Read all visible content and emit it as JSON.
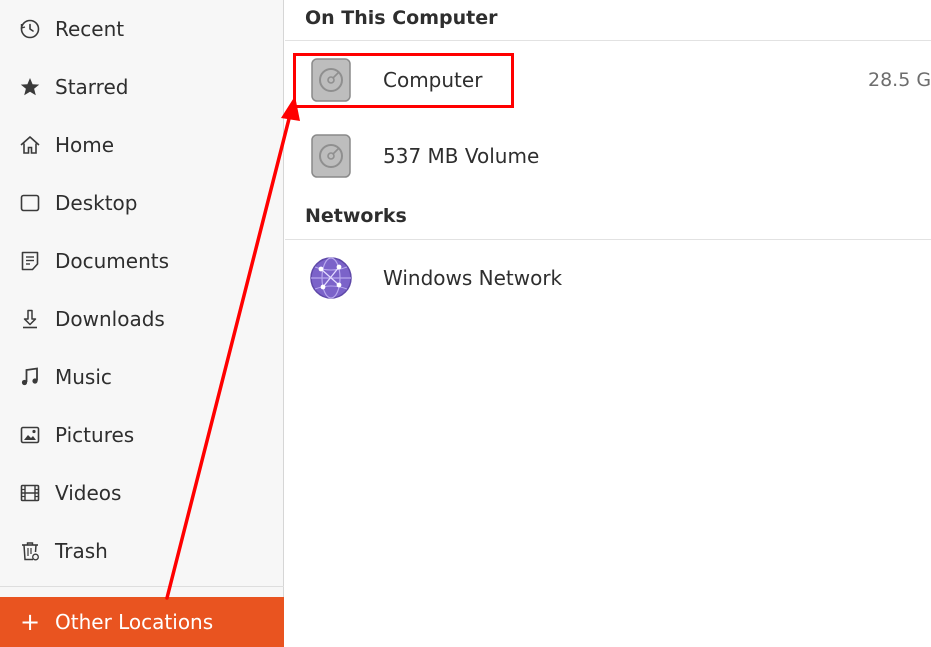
{
  "sidebar": {
    "items": [
      {
        "label": "Recent",
        "icon": "clock-icon"
      },
      {
        "label": "Starred",
        "icon": "star-icon"
      },
      {
        "label": "Home",
        "icon": "home-icon"
      },
      {
        "label": "Desktop",
        "icon": "desktop-icon"
      },
      {
        "label": "Documents",
        "icon": "document-icon"
      },
      {
        "label": "Downloads",
        "icon": "download-icon"
      },
      {
        "label": "Music",
        "icon": "music-icon"
      },
      {
        "label": "Pictures",
        "icon": "picture-icon"
      },
      {
        "label": "Videos",
        "icon": "video-icon"
      },
      {
        "label": "Trash",
        "icon": "trash-icon"
      }
    ],
    "other_locations": {
      "label": "Other Locations",
      "icon": "plus-icon",
      "glyph": "+"
    }
  },
  "main": {
    "on_this_computer": {
      "title": "On This Computer",
      "rows": [
        {
          "name": "Computer",
          "size": "28.5 G",
          "icon": "drive-icon"
        },
        {
          "name": "537 MB Volume",
          "size": "",
          "icon": "drive-icon"
        }
      ]
    },
    "networks": {
      "title": "Networks",
      "rows": [
        {
          "name": "Windows Network",
          "icon": "network-globe-icon"
        }
      ]
    }
  },
  "colors": {
    "accent": "#e95420",
    "annotation": "#ff0000",
    "sidebar_bg": "#f7f7f7"
  }
}
